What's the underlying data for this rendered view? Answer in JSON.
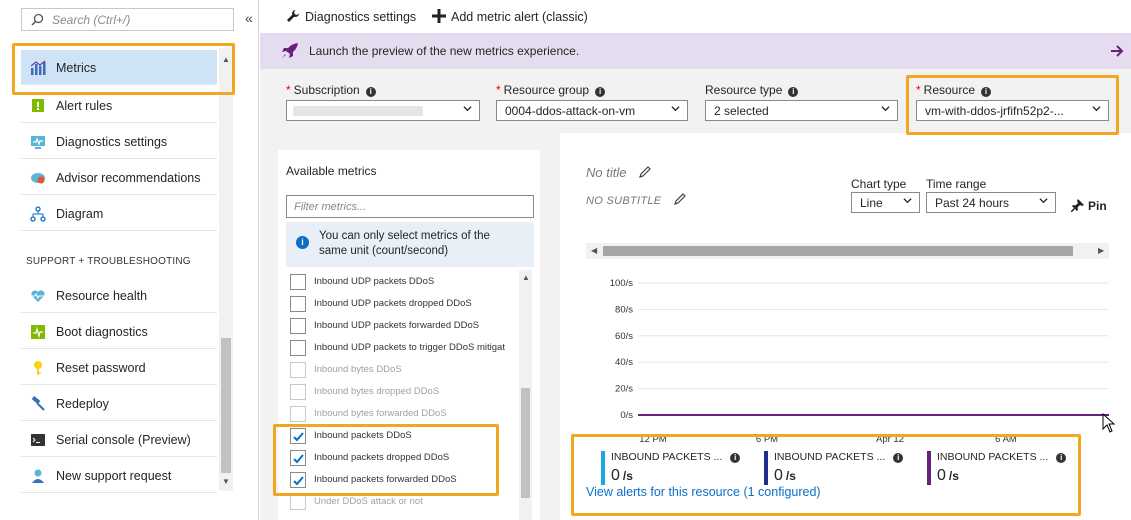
{
  "sidebar": {
    "search_placeholder": "Search (Ctrl+/)",
    "collapse_glyph": "«",
    "items": [
      {
        "label": "Metrics",
        "icon": "metrics-icon",
        "selected": true
      },
      {
        "label": "Alert rules",
        "icon": "alert-rules-icon"
      },
      {
        "label": "Diagnostics settings",
        "icon": "diagnostics-icon"
      },
      {
        "label": "Advisor recommendations",
        "icon": "advisor-icon"
      },
      {
        "label": "Diagram",
        "icon": "diagram-icon"
      }
    ],
    "section_header": "SUPPORT + TROUBLESHOOTING",
    "support_items": [
      {
        "label": "Resource health",
        "icon": "heart-icon"
      },
      {
        "label": "Boot diagnostics",
        "icon": "boot-diagnostics-icon"
      },
      {
        "label": "Reset password",
        "icon": "key-icon"
      },
      {
        "label": "Redeploy",
        "icon": "hammer-icon"
      },
      {
        "label": "Serial console (Preview)",
        "icon": "console-icon"
      },
      {
        "label": "New support request",
        "icon": "support-person-icon"
      }
    ]
  },
  "toolbar": {
    "diagnostics_label": "Diagnostics settings",
    "add_alert_label": "Add metric alert (classic)"
  },
  "banner": {
    "text": "Launch the preview of the new metrics experience."
  },
  "filters": {
    "subscription_label": "Subscription",
    "subscription_value": "",
    "resource_group_label": "Resource group",
    "resource_group_value": "0004-ddos-attack-on-vm",
    "resource_type_label": "Resource type",
    "resource_type_value": "2 selected",
    "resource_label": "Resource",
    "resource_value": "vm-with-ddos-jrfifn52p2-..."
  },
  "metrics_panel": {
    "title": "Available metrics",
    "filter_placeholder": "Filter metrics...",
    "info_text_line1": "You can only select metrics of the",
    "info_text_line2": "same unit (count/second)",
    "rows": [
      {
        "label": "Inbound UDP packets DDoS",
        "checked": false,
        "disabled": false
      },
      {
        "label": "Inbound UDP packets dropped DDoS",
        "checked": false,
        "disabled": false
      },
      {
        "label": "Inbound UDP packets forwarded DDoS",
        "checked": false,
        "disabled": false
      },
      {
        "label": "Inbound UDP packets to trigger DDoS mitigat",
        "checked": false,
        "disabled": false
      },
      {
        "label": "Inbound bytes DDoS",
        "checked": false,
        "disabled": true
      },
      {
        "label": "Inbound bytes dropped DDoS",
        "checked": false,
        "disabled": true
      },
      {
        "label": "Inbound bytes forwarded DDoS",
        "checked": false,
        "disabled": true
      },
      {
        "label": "Inbound packets DDoS",
        "checked": true,
        "disabled": false
      },
      {
        "label": "Inbound packets dropped DDoS",
        "checked": true,
        "disabled": false
      },
      {
        "label": "Inbound packets forwarded DDoS",
        "checked": true,
        "disabled": false
      },
      {
        "label": "Under DDoS attack or not",
        "checked": false,
        "disabled": true
      }
    ]
  },
  "chart": {
    "title": "No title",
    "subtitle": "NO SUBTITLE",
    "chart_type_label": "Chart type",
    "chart_type_value": "Line",
    "time_range_label": "Time range",
    "time_range_value": "Past 24 hours",
    "pin_label": "Pin",
    "y_ticks": [
      "100/s",
      "80/s",
      "60/s",
      "40/s",
      "20/s",
      "0/s"
    ],
    "x_ticks": [
      "12 PM",
      "6 PM",
      "Apr 12",
      "6 AM"
    ],
    "legend": [
      {
        "name": "INBOUND PACKETS ...",
        "value": "0",
        "unit": "/s",
        "color": "#1aa9e0"
      },
      {
        "name": "INBOUND PACKETS ...",
        "value": "0",
        "unit": "/s",
        "color": "#1d2f8c"
      },
      {
        "name": "INBOUND PACKETS ...",
        "value": "0",
        "unit": "/s",
        "color": "#68217a"
      }
    ],
    "alerts_link": "View alerts for this resource (1 configured)"
  },
  "colors": {
    "highlight": "#f4a522",
    "link": "#0b6fc7",
    "banner_bg": "#e6dcef",
    "selected_bg": "#cfe3f6"
  },
  "chart_data": {
    "type": "line",
    "title": "",
    "xlabel": "",
    "ylabel": "",
    "x": [
      "12 PM",
      "6 PM",
      "Apr 12",
      "6 AM"
    ],
    "ylim": [
      0,
      100
    ],
    "series": [
      {
        "values": [
          0,
          0,
          0,
          0
        ]
      },
      {
        "values": [
          0,
          0,
          0,
          0
        ]
      },
      {
        "values": [
          0,
          0,
          0,
          0
        ]
      }
    ]
  }
}
